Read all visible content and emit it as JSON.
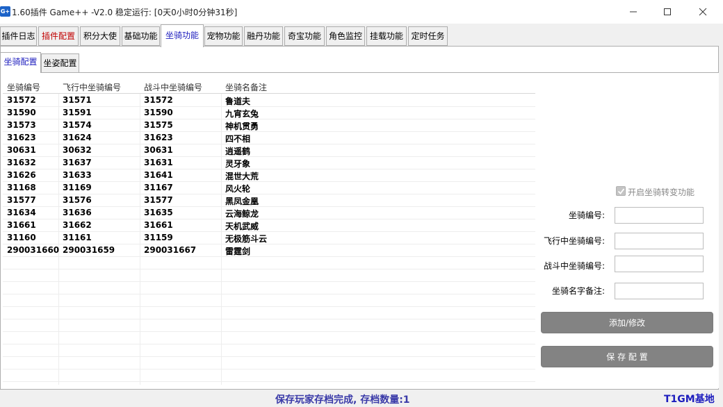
{
  "window": {
    "icon_text": "G+",
    "title": "1.60插件 Game++ -V2.0 稳定运行: [0天0小时0分钟31秒]"
  },
  "tabs": [
    {
      "label": "插件日志"
    },
    {
      "label": "插件配置"
    },
    {
      "label": "积分大使"
    },
    {
      "label": "基础功能"
    },
    {
      "label": "坐骑功能"
    },
    {
      "label": "宠物功能"
    },
    {
      "label": "融丹功能"
    },
    {
      "label": "奇宝功能"
    },
    {
      "label": "角色监控"
    },
    {
      "label": "挂载功能"
    },
    {
      "label": "定时任务"
    }
  ],
  "subtabs": [
    {
      "label": "坐骑配置"
    },
    {
      "label": "坐姿配置"
    }
  ],
  "table": {
    "headers": [
      "坐骑编号",
      "飞行中坐骑编号",
      "战斗中坐骑编号",
      "坐骑名备注"
    ],
    "rows": [
      [
        "31572",
        "31571",
        "31572",
        "鲁道夫"
      ],
      [
        "31590",
        "31591",
        "31590",
        "九宵玄兔"
      ],
      [
        "31573",
        "31574",
        "31575",
        "神机贯勇"
      ],
      [
        "31623",
        "31624",
        "31623",
        "四不相"
      ],
      [
        "30631",
        "30632",
        "30631",
        "逍遥鹤"
      ],
      [
        "31632",
        "31637",
        "31631",
        "灵牙象"
      ],
      [
        "31626",
        "31633",
        "31641",
        "混世大荒"
      ],
      [
        "31168",
        "31169",
        "31167",
        "风火轮"
      ],
      [
        "31577",
        "31576",
        "31577",
        "黑凤金凰"
      ],
      [
        "31634",
        "31636",
        "31635",
        "云海鲸龙"
      ],
      [
        "31661",
        "31662",
        "31661",
        "天机武威"
      ],
      [
        "31160",
        "31161",
        "31159",
        "无极筋斗云"
      ],
      [
        "290031660",
        "290031659",
        "290031667",
        "雷霆剑"
      ]
    ]
  },
  "form": {
    "enable_label": "开启坐骑转变功能",
    "enable_checked": true,
    "mount_id_label": "坐骑编号:",
    "flying_id_label": "飞行中坐骑编号:",
    "battle_id_label": "战斗中坐骑编号:",
    "note_label": "坐骑名字备注:",
    "add_button": "添加/修改",
    "save_button": "保 存 配 置"
  },
  "status": {
    "message": "保存玩家存档完成, 存档数量:1",
    "brand": "T1GM基地"
  },
  "colors": {
    "active_tab_text": "#1d1dbe",
    "red_tab_text": "#c00000",
    "button_bg": "#838383",
    "status_text": "#3a3aa8"
  }
}
